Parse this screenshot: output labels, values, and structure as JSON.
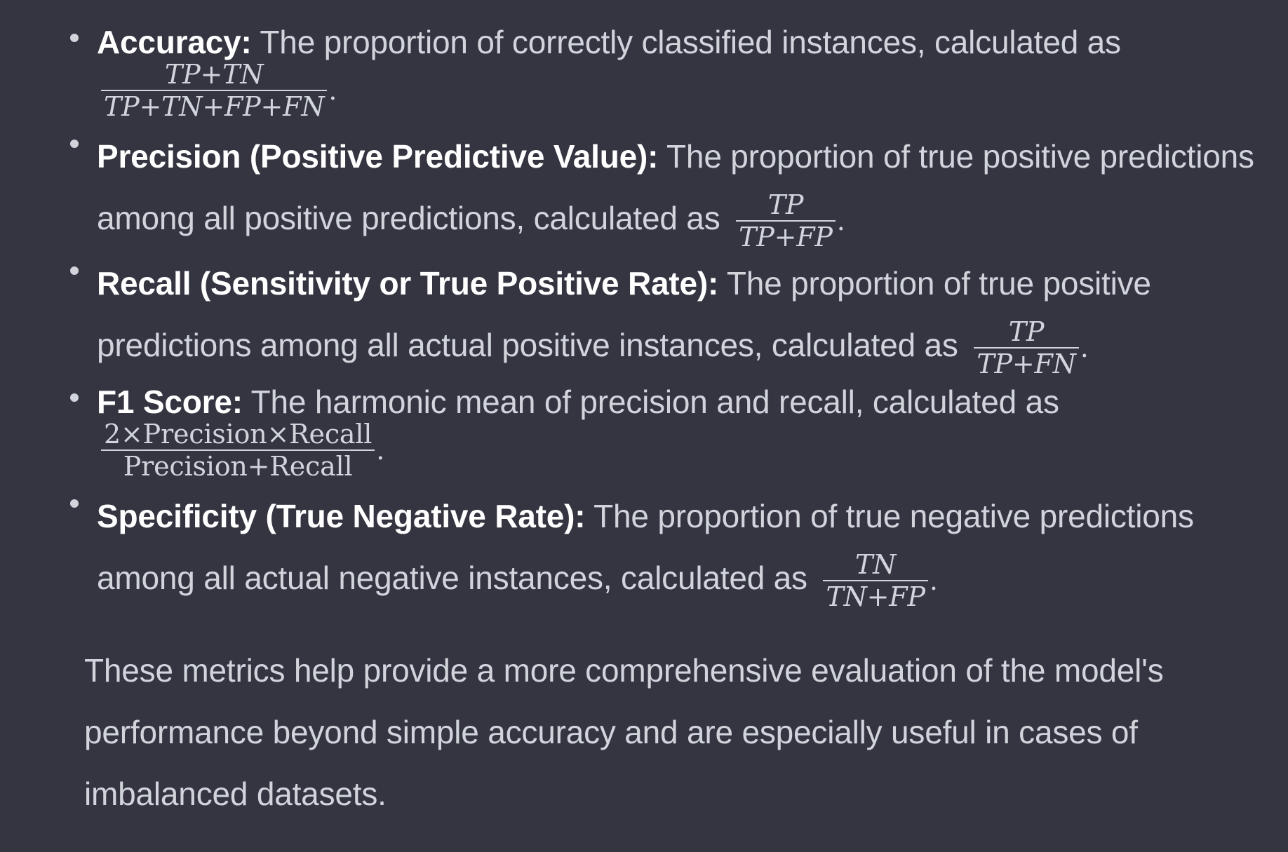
{
  "metrics": [
    {
      "term": "Accuracy:",
      "description": "The proportion of correctly classified instances, calculated as",
      "formula": {
        "numerator": "TP+TN",
        "denominator": "TP+TN+FP+FN"
      },
      "end": "."
    },
    {
      "term": "Precision (Positive Predictive Value):",
      "description": "The proportion of true positive predictions among all positive predictions, calculated as",
      "formula": {
        "numerator": "TP",
        "denominator": "TP+FP"
      },
      "end": "."
    },
    {
      "term": "Recall (Sensitivity or True Positive Rate):",
      "description": "The proportion of true positive predictions among all actual positive instances, calculated as",
      "formula": {
        "numerator": "TP",
        "denominator": "TP+FN"
      },
      "end": "."
    },
    {
      "term": "F1 Score:",
      "description": "The harmonic mean of precision and recall, calculated as",
      "formula": {
        "numerator": "2×Precision×Recall",
        "denominator": "Precision+Recall"
      },
      "end": "."
    },
    {
      "term": "Specificity (True Negative Rate):",
      "description": "The proportion of true negative predictions among all actual negative instances, calculated as",
      "formula": {
        "numerator": "TN",
        "denominator": "TN+FP"
      },
      "end": "."
    }
  ],
  "summary": "These metrics help provide a more comprehensive evaluation of the model's performance beyond simple accuracy and are especially useful in cases of imbalanced datasets.",
  "colors": {
    "background": "#343541",
    "text": "#d1d5db",
    "term": "#ffffff"
  }
}
